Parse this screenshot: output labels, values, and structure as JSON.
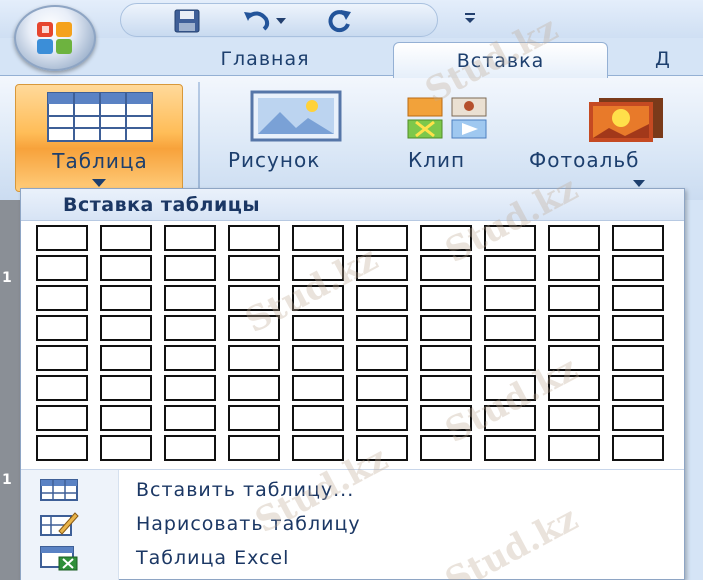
{
  "quick_access": {
    "save_icon": "save-icon",
    "undo_icon": "undo-icon",
    "redo_icon": "redo-icon",
    "customize_icon": "customize-icon"
  },
  "tabs": {
    "home": "Главная",
    "insert": "Вставка",
    "next_partial": "Д"
  },
  "ribbon": {
    "table_label": "Таблица",
    "picture_label": "Рисунок",
    "clip_label": "Клип",
    "album_label": "Фотоальб"
  },
  "dropdown": {
    "title": "Вставка таблицы",
    "grid": {
      "columns": 10,
      "rows": 8
    },
    "items": [
      {
        "label": "Вставить таблицу...",
        "icon": "insert-table-icon"
      },
      {
        "label": "Нарисовать таблицу",
        "icon": "draw-table-icon"
      },
      {
        "label": "Таблица Excel",
        "icon": "excel-table-icon"
      }
    ]
  },
  "doc": {
    "line_numbers": [
      "1",
      "1"
    ]
  },
  "watermark": "Stud.kz",
  "colors": {
    "accent_orange": "#ffbd58",
    "ribbon_blue": "#d5e4f6",
    "text_blue": "#1b3764"
  }
}
